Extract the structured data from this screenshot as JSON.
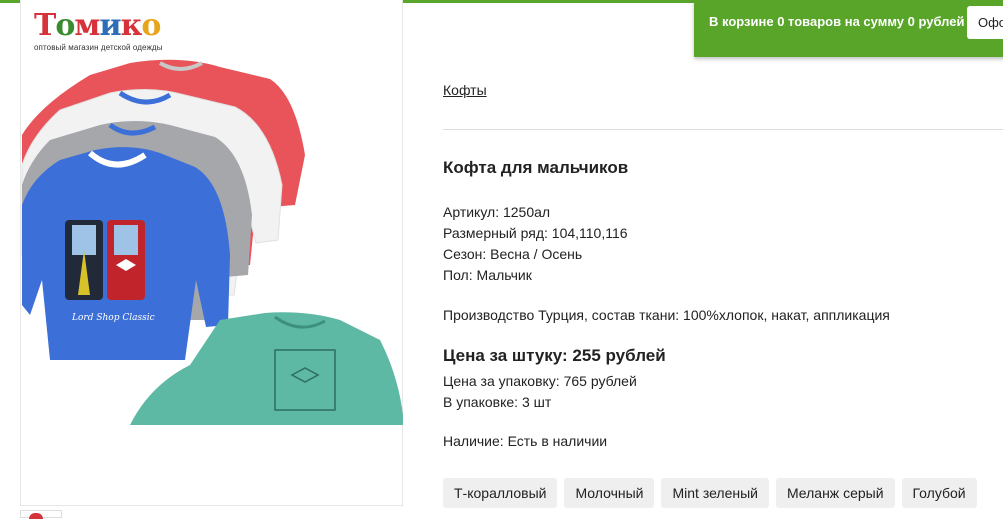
{
  "cart": {
    "prefix": "В корзине ",
    "count": "0 товаров",
    "middle": " на сумму ",
    "sum": "0 рублей",
    "checkout_label": "Оформить"
  },
  "logo": {
    "word_parts": [
      "Т",
      "о",
      "м",
      "и",
      "к",
      "о"
    ],
    "tagline": "оптовый магазин детской одежды"
  },
  "breadcrumb": "Кофты",
  "product": {
    "title": "Кофта для мальчиков",
    "specs": [
      "Артикул: 1250ал",
      "Размерный ряд: 104,110,116",
      "Сезон: Весна / Осень",
      "Пол: Мальчик"
    ],
    "production": "Производство Турция, состав ткани: 100%хлопок, накат, аппликация",
    "price_unit": "Цена за штуку: 255 рублей",
    "price_pack": "Цена за упаковку: 765 рублей",
    "pack_count": "В упаковке: 3 шт",
    "stock": "Наличие: Есть в наличии",
    "colors": [
      "Т-коралловый",
      "Молочный",
      "Мint зеленый",
      "Меланж серый",
      "Голубой"
    ],
    "image_caption": "Lord Shop Classic"
  },
  "theme": {
    "accent": "#58a52a",
    "chip_bg": "#efefef",
    "shirt_colors": [
      "#e8545a",
      "#f2f2f2",
      "#a5a7ab",
      "#3d6fd8",
      "#5db8a4"
    ]
  }
}
